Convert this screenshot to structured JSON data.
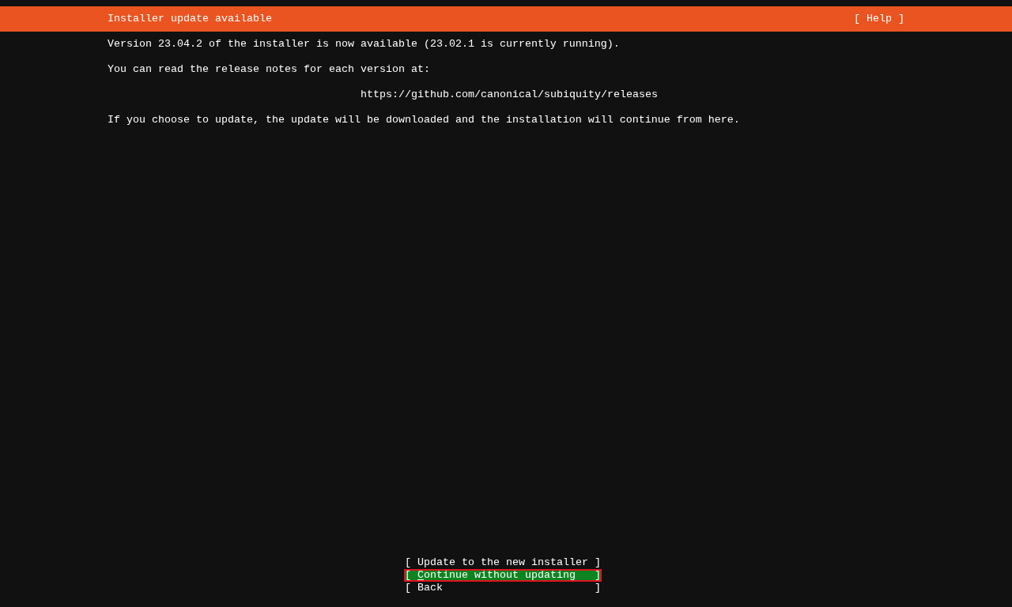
{
  "header": {
    "title": "Installer update available",
    "help": "[ Help ]"
  },
  "paragraphs": [
    {
      "kind": "text",
      "text": "Version 23.04.2 of the installer is now available (23.02.1 is currently running)."
    },
    {
      "kind": "text",
      "text": "You can read the release notes for each version at:"
    },
    {
      "kind": "link",
      "text": "https://github.com/canonical/subiquity/releases"
    },
    {
      "kind": "text",
      "text": "If you choose to update, the update will be downloaded and the installation will continue from here."
    }
  ],
  "buttons": [
    {
      "open": "[",
      "label": "Update to the new installer",
      "close": "]",
      "selected": false,
      "annotated": false
    },
    {
      "open": "[",
      "label": "Continue without updating",
      "close": "]",
      "selected": true,
      "annotated": true
    },
    {
      "open": "[",
      "label": "Back",
      "close": "]",
      "selected": false,
      "annotated": false
    }
  ]
}
